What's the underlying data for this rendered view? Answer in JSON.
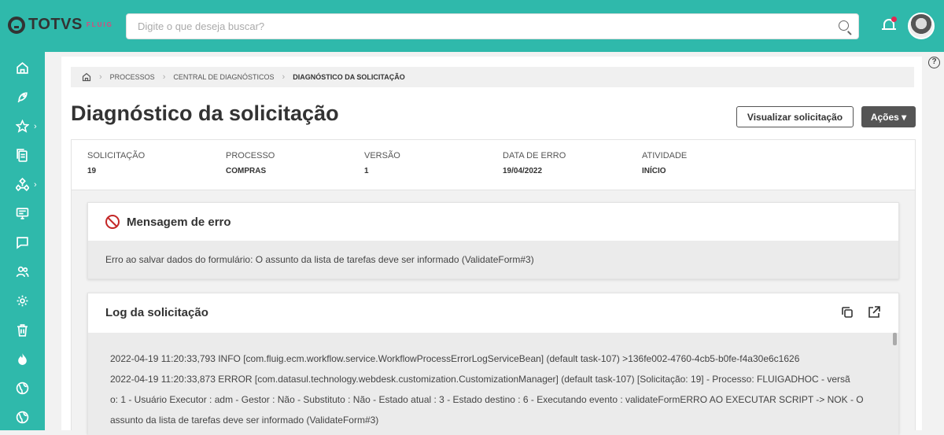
{
  "header": {
    "logo_text": "TOTVS",
    "logo_sub": "FLUIG",
    "search_placeholder": "Digite o que deseja buscar?"
  },
  "breadcrumb": {
    "items": [
      "PROCESSOS",
      "CENTRAL DE DIAGNÓSTICOS",
      "DIAGNÓSTICO DA SOLICITAÇÃO"
    ]
  },
  "page": {
    "title": "Diagnóstico da solicitação",
    "btn_view": "Visualizar solicitação",
    "btn_actions": "Ações ▾",
    "help": "?"
  },
  "info": {
    "solicitacao_label": "SOLICITAÇÃO",
    "solicitacao_value": "19",
    "processo_label": "PROCESSO",
    "processo_value": "COMPRAS",
    "versao_label": "VERSÃO",
    "versao_value": "1",
    "data_label": "DATA DE ERRO",
    "data_value": "19/04/2022",
    "atividade_label": "ATIVIDADE",
    "atividade_value": "INÍCIO"
  },
  "error_card": {
    "title": "Mensagem de erro",
    "message": "Erro ao salvar dados do formulário: O assunto da lista de tarefas deve ser informado (ValidateForm#3)"
  },
  "log_card": {
    "title": "Log da solicitação",
    "line1": "2022-04-19 11:20:33,793 INFO [com.fluig.ecm.workflow.service.WorkflowProcessErrorLogServiceBean] (default task-107) >136fe002-4760-4cb5-b0fe-f4a30e6c1626",
    "line2": "2022-04-19 11:20:33,873 ERROR [com.datasul.technology.webdesk.customization.CustomizationManager] (default task-107) [Solicitação: 19] - Processo: FLUIGADHOC - versã",
    "line3": "o: 1 - Usuário Executor : adm - Gestor : Não - Substituto : Não - Estado atual : 3 - Estado destino : 6 - Executando evento : validateFormERRO AO EXECUTAR SCRIPT -> NOK - O",
    "line4": "assunto da lista de tarefas deve ser informado (ValidateForm#3)"
  }
}
